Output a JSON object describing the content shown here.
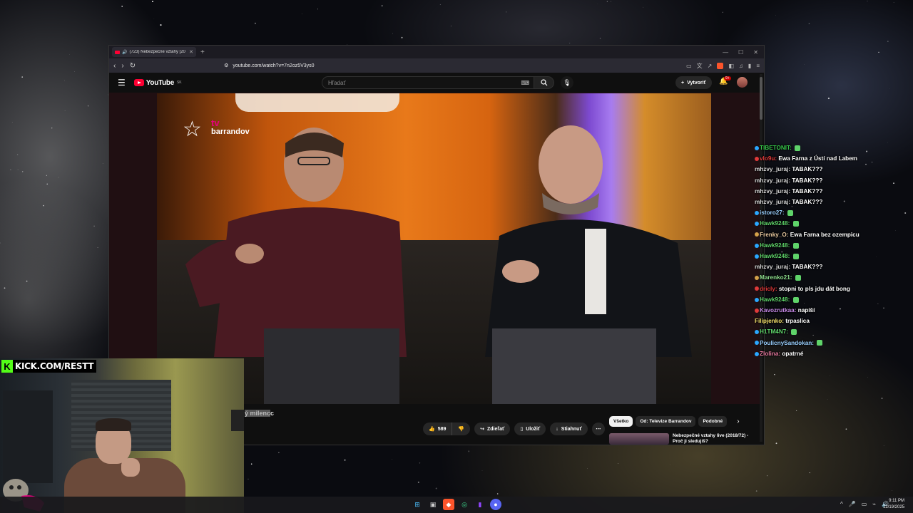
{
  "browser": {
    "tab_title": "(723) Nebezpečné vztahy [20",
    "url": "youtube.com/watch?v=7n2oz5V3ys0",
    "new_tab": "+",
    "win_min": "—",
    "win_max": "☐",
    "win_close": "✕"
  },
  "youtube": {
    "logo_text": "YouTube",
    "logo_region": "SK",
    "search_placeholder": "Hľadať",
    "create_label": "Vytvoriť",
    "notif_count": "9+",
    "video_logo_text": "barrandov",
    "video_logo_tv": "tv",
    "caption_hl": "ý milenc",
    "caption_rest": "c",
    "like_count": "589",
    "share_label": "Zdieľať",
    "save_label": "Uložiť",
    "download_label": "Stiahnuť",
    "chips": [
      "Všetko",
      "Od: Televize Barrandov",
      "Podobné"
    ],
    "rec_title": "Nebezpečné vztahy live (2018/72) - Proč ji sledujíš?"
  },
  "chat": [
    {
      "user": "TIBETONIT:",
      "msg": "",
      "color": "#37c84a",
      "badge": "#2aa7ff"
    },
    {
      "user": "vlo9u:",
      "msg": "Ewa Farna z Ústí nad Labem",
      "color": "#e03a3a",
      "badge": "#e03a3a"
    },
    {
      "user": "mhzvy_juraj:",
      "msg": "TABAK???",
      "color": "#d8d8d8",
      "badge": ""
    },
    {
      "user": "mhzvy_juraj:",
      "msg": "TABAK???",
      "color": "#d8d8d8",
      "badge": ""
    },
    {
      "user": "mhzvy_juraj:",
      "msg": "TABAK???",
      "color": "#d8d8d8",
      "badge": ""
    },
    {
      "user": "mhzvy_juraj:",
      "msg": "TABAK???",
      "color": "#d8d8d8",
      "badge": ""
    },
    {
      "user": "istoro27:",
      "msg": "",
      "color": "#9ad0ff",
      "badge": "#2aa7ff"
    },
    {
      "user": "Hawk9248:",
      "msg": "",
      "color": "#5fd46a",
      "badge": "#2aa7ff"
    },
    {
      "user": "Frenky_O:",
      "msg": "Ewa Farna bez ozempicu",
      "color": "#e8c9a0",
      "badge": "#d4a14a"
    },
    {
      "user": "Hawk9248:",
      "msg": "",
      "color": "#5fd46a",
      "badge": "#2aa7ff"
    },
    {
      "user": "Hawk9248:",
      "msg": "",
      "color": "#5fd46a",
      "badge": "#2aa7ff"
    },
    {
      "user": "mhzvy_juraj:",
      "msg": "TABAK???",
      "color": "#d8d8d8",
      "badge": ""
    },
    {
      "user": "Marenko21:",
      "msg": "",
      "color": "#8fe08f",
      "badge": "#d4a14a"
    },
    {
      "user": "dricly:",
      "msg": "stopni to pls jdu dát bong",
      "color": "#e03a3a",
      "badge": "#e03a3a"
    },
    {
      "user": "Hawk9248:",
      "msg": "",
      "color": "#5fd46a",
      "badge": "#2aa7ff"
    },
    {
      "user": "Kavozrutkaa:",
      "msg": "napíší",
      "color": "#c78ae8",
      "badge": "#e03a3a"
    },
    {
      "user": "Filipjenko:",
      "msg": "trpaslica",
      "color": "#f3e06b",
      "badge": ""
    },
    {
      "user": "H1TM4N7:",
      "msg": "",
      "color": "#5fd46a",
      "badge": "#2aa7ff"
    },
    {
      "user": "PoulicnySandokan:",
      "msg": "",
      "color": "#9ad0ff",
      "badge": "#2aa7ff"
    },
    {
      "user": "Zlolina:",
      "msg": "opatrné",
      "color": "#e87aa0",
      "badge": "#2aa7ff"
    }
  ],
  "kick": {
    "url": "KICK.COM/RESTT",
    "logo": "K"
  },
  "taskbar": {
    "time": "9:11 PM",
    "date": "12/19/2025"
  },
  "colors": {
    "yt_red": "#ff0033",
    "kick_green": "#53fc18",
    "brand_pink": "#e6007e"
  }
}
